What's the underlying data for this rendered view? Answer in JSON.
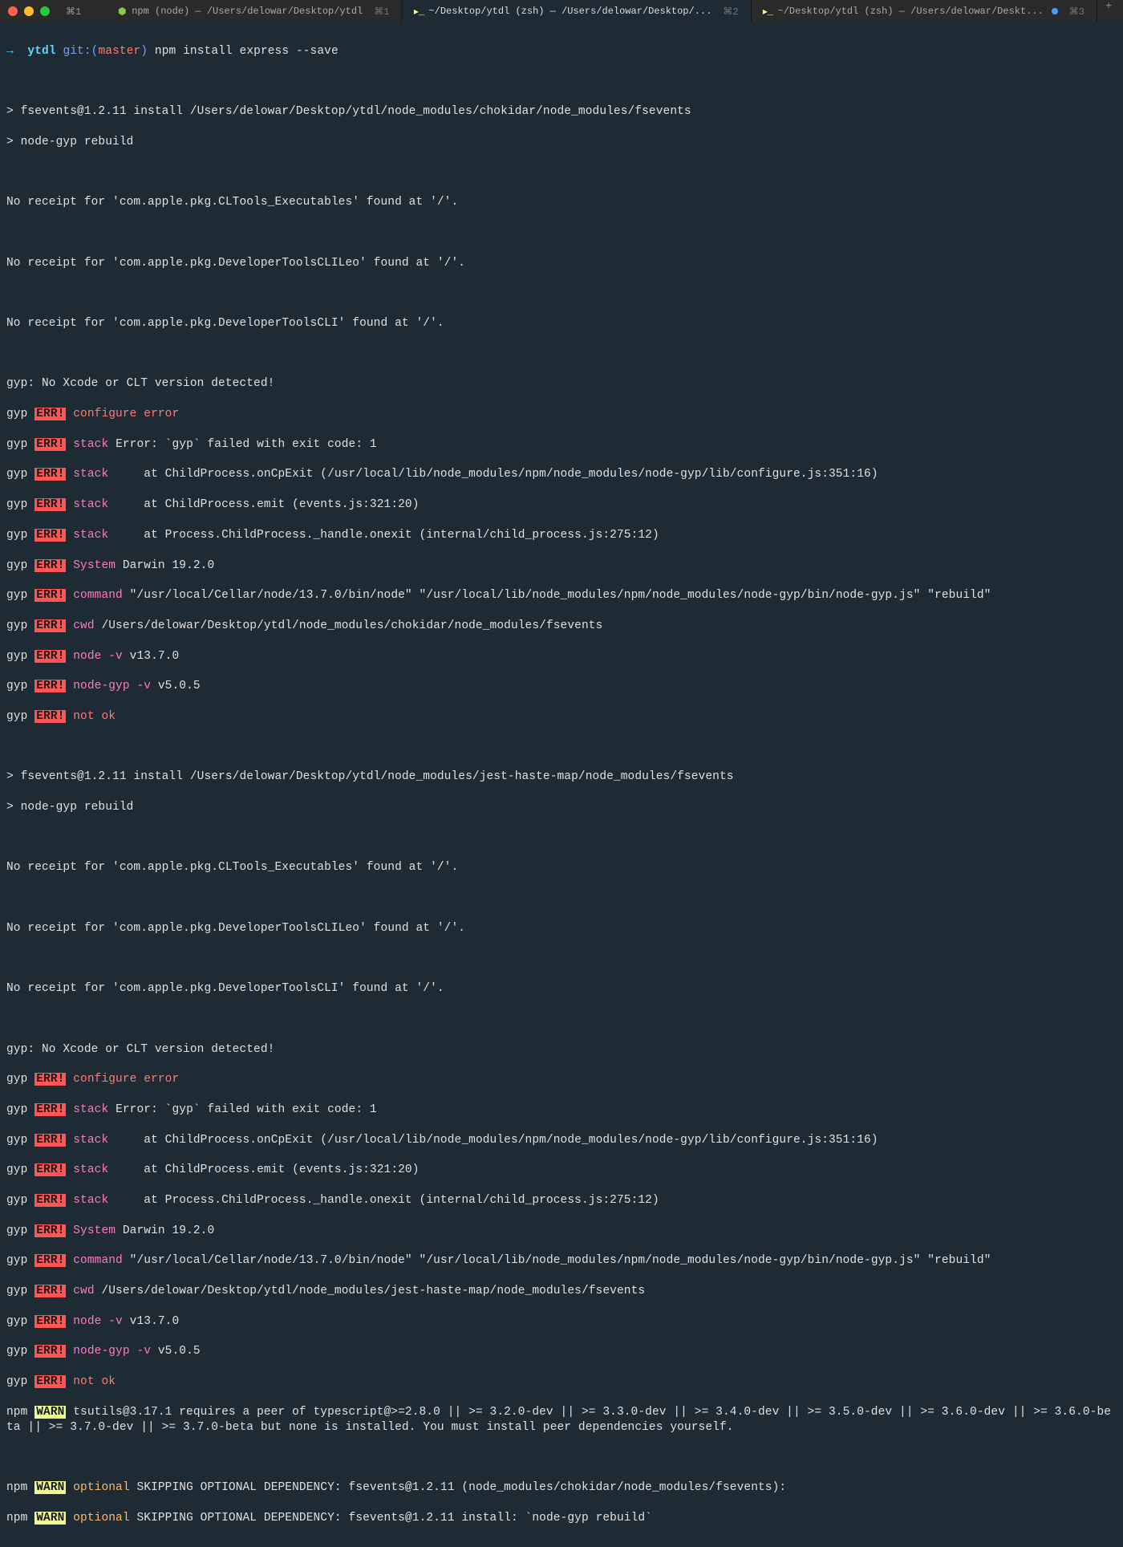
{
  "titlebar": {
    "win_shortcut": "⌘1",
    "tabs": [
      {
        "icon": "node-icon",
        "title": "npm (node) — /Users/delowar/Desktop/ytdl",
        "shortcut": "⌘1"
      },
      {
        "icon": "terminal-icon",
        "title": "~/Desktop/ytdl (zsh) — /Users/delowar/Desktop/...",
        "shortcut": "⌘2"
      },
      {
        "icon": "terminal-icon",
        "title": "~/Desktop/ytdl (zsh) — /Users/delowar/Deskt...",
        "shortcut": "⌘3",
        "has_dot": true
      }
    ]
  },
  "prompt": {
    "arrow": "→",
    "path": "ytdl",
    "git_label": "git:",
    "branch": "master",
    "command": "npm install express --save"
  },
  "output": {
    "l1": "> fsevents@1.2.11 install /Users/delowar/Desktop/ytdl/node_modules/chokidar/node_modules/fsevents",
    "l2": "> node-gyp rebuild",
    "l3": "No receipt for 'com.apple.pkg.CLTools_Executables' found at '/'.",
    "l4": "No receipt for 'com.apple.pkg.DeveloperToolsCLILeo' found at '/'.",
    "l5": "No receipt for 'com.apple.pkg.DeveloperToolsCLI' found at '/'.",
    "l6": "gyp: No Xcode or CLT version detected!",
    "gyp1": {
      "p": "gyp",
      "e": "ERR!",
      "k": "configure error",
      "t": ""
    },
    "gyp2": {
      "p": "gyp",
      "e": "ERR!",
      "k": "stack",
      "t": " Error: `gyp` failed with exit code: 1"
    },
    "gyp3": {
      "p": "gyp",
      "e": "ERR!",
      "k": "stack",
      "t": "     at ChildProcess.onCpExit (/usr/local/lib/node_modules/npm/node_modules/node-gyp/lib/configure.js:351:16)"
    },
    "gyp4": {
      "p": "gyp",
      "e": "ERR!",
      "k": "stack",
      "t": "     at ChildProcess.emit (events.js:321:20)"
    },
    "gyp5": {
      "p": "gyp",
      "e": "ERR!",
      "k": "stack",
      "t": "     at Process.ChildProcess._handle.onexit (internal/child_process.js:275:12)"
    },
    "gyp6": {
      "p": "gyp",
      "e": "ERR!",
      "k": "System",
      "t": " Darwin 19.2.0"
    },
    "gyp7": {
      "p": "gyp",
      "e": "ERR!",
      "k": "command",
      "t": " \"/usr/local/Cellar/node/13.7.0/bin/node\" \"/usr/local/lib/node_modules/npm/node_modules/node-gyp/bin/node-gyp.js\" \"rebuild\""
    },
    "gyp8": {
      "p": "gyp",
      "e": "ERR!",
      "k": "cwd",
      "t": " /Users/delowar/Desktop/ytdl/node_modules/chokidar/node_modules/fsevents"
    },
    "gyp9": {
      "p": "gyp",
      "e": "ERR!",
      "k": "node -v",
      "t": " v13.7.0"
    },
    "gyp10": {
      "p": "gyp",
      "e": "ERR!",
      "k": "node-gyp -v",
      "t": " v5.0.5"
    },
    "gyp11": {
      "p": "gyp",
      "e": "ERR!",
      "k": "not ok",
      "t": ""
    },
    "l7": "> fsevents@1.2.11 install /Users/delowar/Desktop/ytdl/node_modules/jest-haste-map/node_modules/fsevents",
    "l8": "> node-gyp rebuild",
    "l9": "No receipt for 'com.apple.pkg.CLTools_Executables' found at '/'.",
    "l10": "No receipt for 'com.apple.pkg.DeveloperToolsCLILeo' found at '/'.",
    "l11": "No receipt for 'com.apple.pkg.DeveloperToolsCLI' found at '/'.",
    "l12": "gyp: No Xcode or CLT version detected!",
    "gypb1": {
      "p": "gyp",
      "e": "ERR!",
      "k": "configure error",
      "t": ""
    },
    "gypb2": {
      "p": "gyp",
      "e": "ERR!",
      "k": "stack",
      "t": " Error: `gyp` failed with exit code: 1"
    },
    "gypb3": {
      "p": "gyp",
      "e": "ERR!",
      "k": "stack",
      "t": "     at ChildProcess.onCpExit (/usr/local/lib/node_modules/npm/node_modules/node-gyp/lib/configure.js:351:16)"
    },
    "gypb4": {
      "p": "gyp",
      "e": "ERR!",
      "k": "stack",
      "t": "     at ChildProcess.emit (events.js:321:20)"
    },
    "gypb5": {
      "p": "gyp",
      "e": "ERR!",
      "k": "stack",
      "t": "     at Process.ChildProcess._handle.onexit (internal/child_process.js:275:12)"
    },
    "gypb6": {
      "p": "gyp",
      "e": "ERR!",
      "k": "System",
      "t": " Darwin 19.2.0"
    },
    "gypb7": {
      "p": "gyp",
      "e": "ERR!",
      "k": "command",
      "t": " \"/usr/local/Cellar/node/13.7.0/bin/node\" \"/usr/local/lib/node_modules/npm/node_modules/node-gyp/bin/node-gyp.js\" \"rebuild\""
    },
    "gypb8": {
      "p": "gyp",
      "e": "ERR!",
      "k": "cwd",
      "t": " /Users/delowar/Desktop/ytdl/node_modules/jest-haste-map/node_modules/fsevents"
    },
    "gypb9": {
      "p": "gyp",
      "e": "ERR!",
      "k": "node -v",
      "t": " v13.7.0"
    },
    "gypb10": {
      "p": "gyp",
      "e": "ERR!",
      "k": "node-gyp -v",
      "t": " v5.0.5"
    },
    "gypb11": {
      "p": "gyp",
      "e": "ERR!",
      "k": "not ok",
      "t": ""
    },
    "npm1": {
      "p": "npm",
      "w": "WARN",
      "t": " tsutils@3.17.1 requires a peer of typescript@>=2.8.0 || >= 3.2.0-dev || >= 3.3.0-dev || >= 3.4.0-dev || >= 3.5.0-dev || >= 3.6.0-dev || >= 3.6.0-beta || >= 3.7.0-dev || >= 3.7.0-beta but none is installed. You must install peer dependencies yourself."
    },
    "npm2": {
      "p": "npm",
      "w": "WARN",
      "k": "optional",
      "t": " SKIPPING OPTIONAL DEPENDENCY: fsevents@1.2.11 (node_modules/chokidar/node_modules/fsevents):"
    },
    "npm3": {
      "p": "npm",
      "w": "WARN",
      "k": "optional",
      "t": " SKIPPING OPTIONAL DEPENDENCY: fsevents@1.2.11 install: `node-gyp rebuild`"
    }
  }
}
